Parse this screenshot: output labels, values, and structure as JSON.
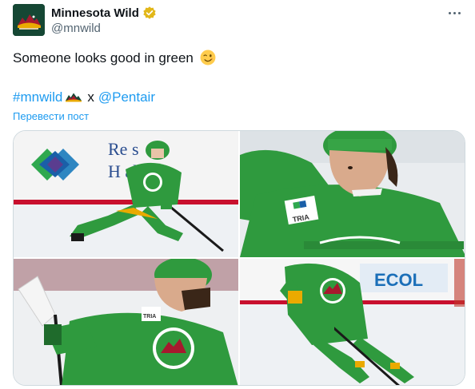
{
  "author": {
    "display_name": "Minnesota Wild",
    "handle": "@mnwild",
    "avatar_icon": "minnesota-wild-logo",
    "verified_icon": "gold-verified-badge-icon",
    "verified_color": "#e2b719"
  },
  "menu": {
    "icon": "more-dots-icon"
  },
  "tweet": {
    "text": "Someone looks good in green",
    "emoji": "winking-face-emoji",
    "hashtag": "#mnwild",
    "hashtag_emoji": "wild-logo-emoji",
    "separator": "x",
    "mention": "@Pentair",
    "translate_label": "Перевести пост"
  },
  "media": {
    "photos": [
      {
        "name": "skating-player-rink-boards",
        "logo_text": "Re    s",
        "logo_text2": "H    al"
      },
      {
        "name": "player-closeup-green-jersey",
        "patch_text": "TRIA"
      },
      {
        "name": "player-holding-stick-closeup",
        "patch_text": "TRIA"
      },
      {
        "name": "player-skating-puck",
        "board_text": "ECOL"
      }
    ]
  },
  "colors": {
    "link": "#1d9bf0",
    "jersey_green": "#2f9a3e",
    "wild_dark_green": "#154734",
    "secondary_text": "#536471"
  }
}
